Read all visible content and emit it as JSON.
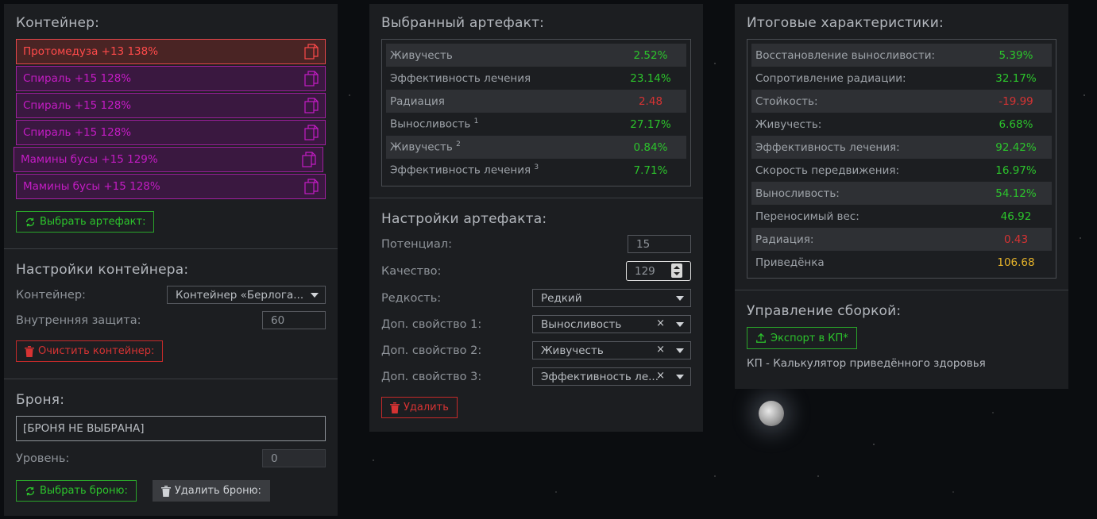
{
  "container_panel": {
    "title": "Контейнер:",
    "artifacts": [
      {
        "label": "Протомедуза +13 138%",
        "color": "red"
      },
      {
        "label": "Спираль +15 128%",
        "color": "purple"
      },
      {
        "label": "Спираль +15 128%",
        "color": "purple"
      },
      {
        "label": "Спираль +15 128%",
        "color": "purple"
      },
      {
        "label": "Мамины бусы +15 129%",
        "color": "purple"
      },
      {
        "label": "Мамины бусы +15 128%",
        "color": "purple"
      }
    ],
    "select_artifact_btn": "Выбрать артефакт:",
    "settings_title": "Настройки контейнера:",
    "container_label": "Контейнер:",
    "container_value": "Контейнер «Берлога...",
    "protection_label": "Внутренняя защита:",
    "protection_value": "60",
    "clear_btn": "Очистить контейнер:",
    "armor_title": "Броня:",
    "armor_value": "[БРОНЯ НЕ ВЫБРАНА]",
    "level_label": "Уровень:",
    "level_value": "0",
    "select_armor_btn": "Выбрать броню:",
    "delete_armor_btn": "Удалить броню:"
  },
  "artifact_panel": {
    "title": "Выбранный артефакт:",
    "stats": [
      {
        "label": "Живучесть",
        "sup": "",
        "value": "2.52%",
        "color": "green"
      },
      {
        "label": "Эффективность лечения",
        "sup": "",
        "value": "23.14%",
        "color": "green"
      },
      {
        "label": "Радиация",
        "sup": "",
        "value": "2.48",
        "color": "red"
      },
      {
        "label": "Выносливость",
        "sup": "1",
        "value": "27.17%",
        "color": "green"
      },
      {
        "label": "Живучесть",
        "sup": "2",
        "value": "0.84%",
        "color": "green"
      },
      {
        "label": "Эффективность лечения",
        "sup": "3",
        "value": "7.71%",
        "color": "green"
      }
    ],
    "settings_title": "Настройки артефакта:",
    "potential_label": "Потенциал:",
    "potential_value": "15",
    "quality_label": "Качество:",
    "quality_value": "129",
    "rarity_label": "Редкость:",
    "rarity_value": "Редкий",
    "extra1_label": "Доп. свойство 1:",
    "extra1_value": "Выносливость",
    "extra2_label": "Доп. свойство 2:",
    "extra2_value": "Живучесть",
    "extra3_label": "Доп. свойство 3:",
    "extra3_value": "Эффективность ле...",
    "delete_btn": "Удалить"
  },
  "totals_panel": {
    "title": "Итоговые характеристики:",
    "stats": [
      {
        "label": "Восстановление выносливости:",
        "value": "5.39%",
        "color": "green"
      },
      {
        "label": "Сопротивление радиации:",
        "value": "32.17%",
        "color": "green"
      },
      {
        "label": "Стойкость:",
        "value": "-19.99",
        "color": "red"
      },
      {
        "label": "Живучесть:",
        "value": "6.68%",
        "color": "green"
      },
      {
        "label": "Эффективность лечения:",
        "value": "92.42%",
        "color": "green"
      },
      {
        "label": "Скорость передвижения:",
        "value": "16.97%",
        "color": "green"
      },
      {
        "label": "Выносливость:",
        "value": "54.12%",
        "color": "green"
      },
      {
        "label": "Переносимый вес:",
        "value": "46.92",
        "color": "green"
      },
      {
        "label": "Радиация:",
        "value": "0.43",
        "color": "red"
      },
      {
        "label": "Приведёнка",
        "value": "106.68",
        "color": "gold"
      }
    ],
    "build_title": "Управление сборкой:",
    "export_btn": "Экспорт в КП*",
    "footnote": "КП - Калькулятор приведённого здоровья"
  }
}
